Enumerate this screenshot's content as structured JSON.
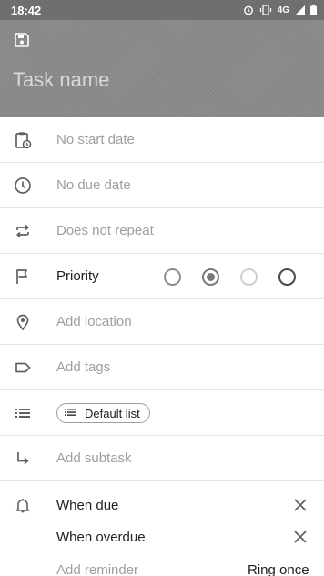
{
  "status_bar": {
    "time": "18:42",
    "network": "4G"
  },
  "header": {
    "task_name_placeholder": "Task name"
  },
  "rows": {
    "start_date": "No start date",
    "due_date": "No due date",
    "repeat": "Does not repeat",
    "priority_label": "Priority",
    "location": "Add location",
    "tags": "Add tags",
    "list_chip": "Default list",
    "subtask": "Add subtask"
  },
  "priority": {
    "selected_index": 1
  },
  "reminders": {
    "items": [
      "When due",
      "When overdue"
    ],
    "add_label": "Add reminder",
    "ring_mode": "Ring once"
  }
}
